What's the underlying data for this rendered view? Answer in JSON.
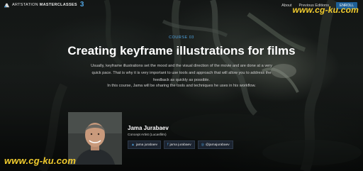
{
  "brand": {
    "prefix": "ARTSTATION",
    "name": "MASTERCLASSES",
    "number": "3"
  },
  "nav": {
    "about": "About",
    "previous": "Previous Editions",
    "enroll": "ENROLL"
  },
  "course": {
    "tag": "COURSE 03",
    "title": "Creating keyframe illustrations for films",
    "description": "Usually, keyframe illustrations set the mood and the visual direction of the movie and are done at a very quick pace. That is why it is very important to use tools and approach that will allow you to address the feedback as quickly as possible.",
    "description2": "In this course, Jama will be sharing the tools and techniques he uses in his workflow."
  },
  "instructor": {
    "name": "Jama Jurabaev",
    "role": "Concept Artist (Lucasfilm)",
    "socials": [
      {
        "icon": "artstation-icon",
        "label": "jama jurabaev"
      },
      {
        "icon": "facebook-icon",
        "label": "jama jurabaev"
      },
      {
        "icon": "instagram-icon",
        "label": "@jamajurabaev"
      }
    ]
  },
  "watermark": {
    "text": "www.cg-ku.com",
    "color": "#f2cc2e"
  },
  "colors": {
    "accent": "#4fa3e0",
    "enroll_bg": "#1e5f96"
  }
}
